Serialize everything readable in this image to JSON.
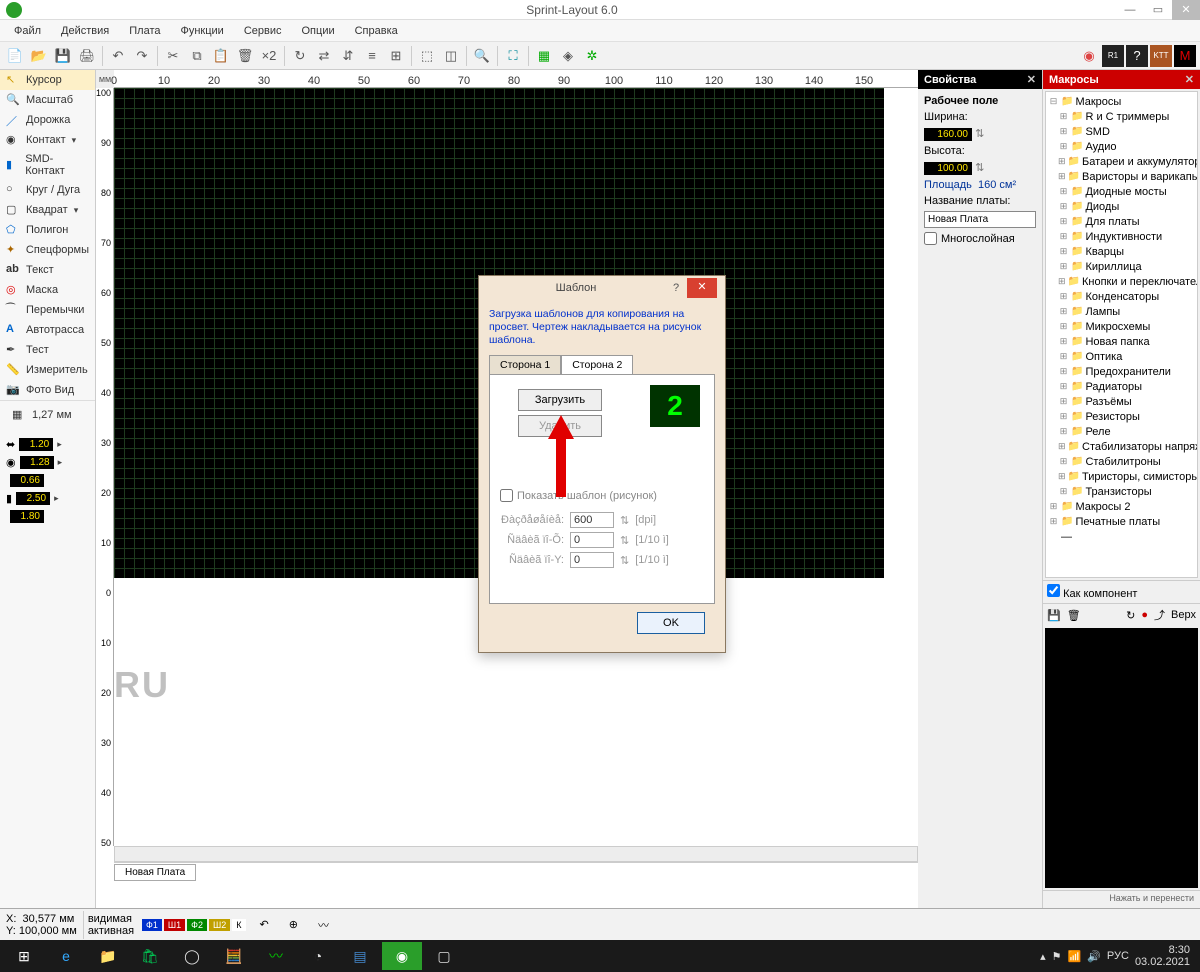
{
  "title": "Sprint-Layout 6.0",
  "menu": [
    "Файл",
    "Действия",
    "Плата",
    "Функции",
    "Сервис",
    "Опции",
    "Справка"
  ],
  "tools": [
    {
      "label": "Курсор",
      "active": true
    },
    {
      "label": "Масштаб"
    },
    {
      "label": "Дорожка"
    },
    {
      "label": "Контакт"
    },
    {
      "label": "SMD-Контакт"
    },
    {
      "label": "Круг / Дуга"
    },
    {
      "label": "Квадрат"
    },
    {
      "label": "Полигон"
    },
    {
      "label": "Спецформы"
    },
    {
      "label": "Текст"
    },
    {
      "label": "Маска"
    },
    {
      "label": "Перемычки"
    },
    {
      "label": "Автотрасса"
    },
    {
      "label": "Тест"
    },
    {
      "label": "Измеритель"
    },
    {
      "label": "Фото Вид"
    }
  ],
  "grid_label": "1,27 мм",
  "params": {
    "v1": "1.20",
    "v2": "1.28",
    "v3": "0.66",
    "v4": "2.50",
    "v5": "1.80"
  },
  "ruler_units": "мм",
  "ruler_top_ticks": [
    "0",
    "10",
    "20",
    "30",
    "40",
    "50",
    "60",
    "70",
    "80",
    "90",
    "100",
    "110",
    "120",
    "130",
    "140",
    "150"
  ],
  "ruler_left_ticks": [
    "100",
    "90",
    "80",
    "70",
    "60",
    "50",
    "40",
    "30",
    "20",
    "10",
    "0",
    "10",
    "20",
    "30",
    "40",
    "50"
  ],
  "watermark": "RU",
  "tab_board": "Новая Плата",
  "props": {
    "title": "Свойства",
    "section": "Рабочее поле",
    "width_lbl": "Ширина:",
    "width": "160.00",
    "height_lbl": "Высота:",
    "height": "100.00",
    "area_lbl": "Площадь",
    "area": "160 см²",
    "name_lbl": "Название платы:",
    "name": "Новая Плата",
    "multi": "Многослойная"
  },
  "macros": {
    "title": "Макросы",
    "root": "Макросы",
    "items": [
      "R и C триммеры",
      "SMD",
      "Аудио",
      "Батареи и аккумуляторы",
      "Варисторы и варикапы",
      "Диодные мосты",
      "Диоды",
      "Для платы",
      "Индуктивности",
      "Кварцы",
      "Кириллица",
      "Кнопки и переключатели",
      "Конденсаторы",
      "Лампы",
      "Микросхемы",
      "Новая папка",
      "Оптика",
      "Предохранители",
      "Радиаторы",
      "Разъёмы",
      "Резисторы",
      "Реле",
      "Стабилизаторы напряжени",
      "Стабилитроны",
      "Тиристоры, симисторы",
      "Транзисторы"
    ],
    "extra": [
      "Макросы 2",
      "Печатные платы"
    ],
    "as_component": "Как компонент",
    "footer": "Нажать и перенести",
    "top_btn": "Верх"
  },
  "status": {
    "x_lbl": "X:",
    "x": "30,577 мм",
    "y_lbl": "Y:",
    "y": "100,000 мм",
    "vis": "видимая",
    "act": "активная",
    "layers": [
      {
        "t": "Ф1",
        "c": "#0030cc"
      },
      {
        "t": "Ш1",
        "c": "#c00000"
      },
      {
        "t": "Ф2",
        "c": "#008800"
      },
      {
        "t": "Ш2",
        "c": "#c0a000"
      },
      {
        "t": "К",
        "c": "#fff",
        "txt": "#000"
      }
    ]
  },
  "taskbar": {
    "lang": "РУС",
    "time": "8:30",
    "date": "03.02.2021"
  },
  "dialog": {
    "title": "Шаблон",
    "desc": "Загрузка шаблонов для копирования на просвет. Чертеж накладывается на рисунок шаблона.",
    "tab1": "Сторона 1",
    "tab2": "Сторона 2",
    "load": "Загрузить",
    "delete": "Удалить",
    "badge": "2",
    "show": "Показать шаблон (рисунок)",
    "res_lbl": "Ðàçðåøåíèå:",
    "res": "600",
    "res_unit": "[dpi]",
    "ox_lbl": "Ñäâèã ïî-Õ:",
    "ox": "0",
    "ox_unit": "[1/10 ì]",
    "oy_lbl": "Ñäâèã ïî-Y:",
    "oy": "0",
    "oy_unit": "[1/10 ì]",
    "ok": "OK"
  }
}
